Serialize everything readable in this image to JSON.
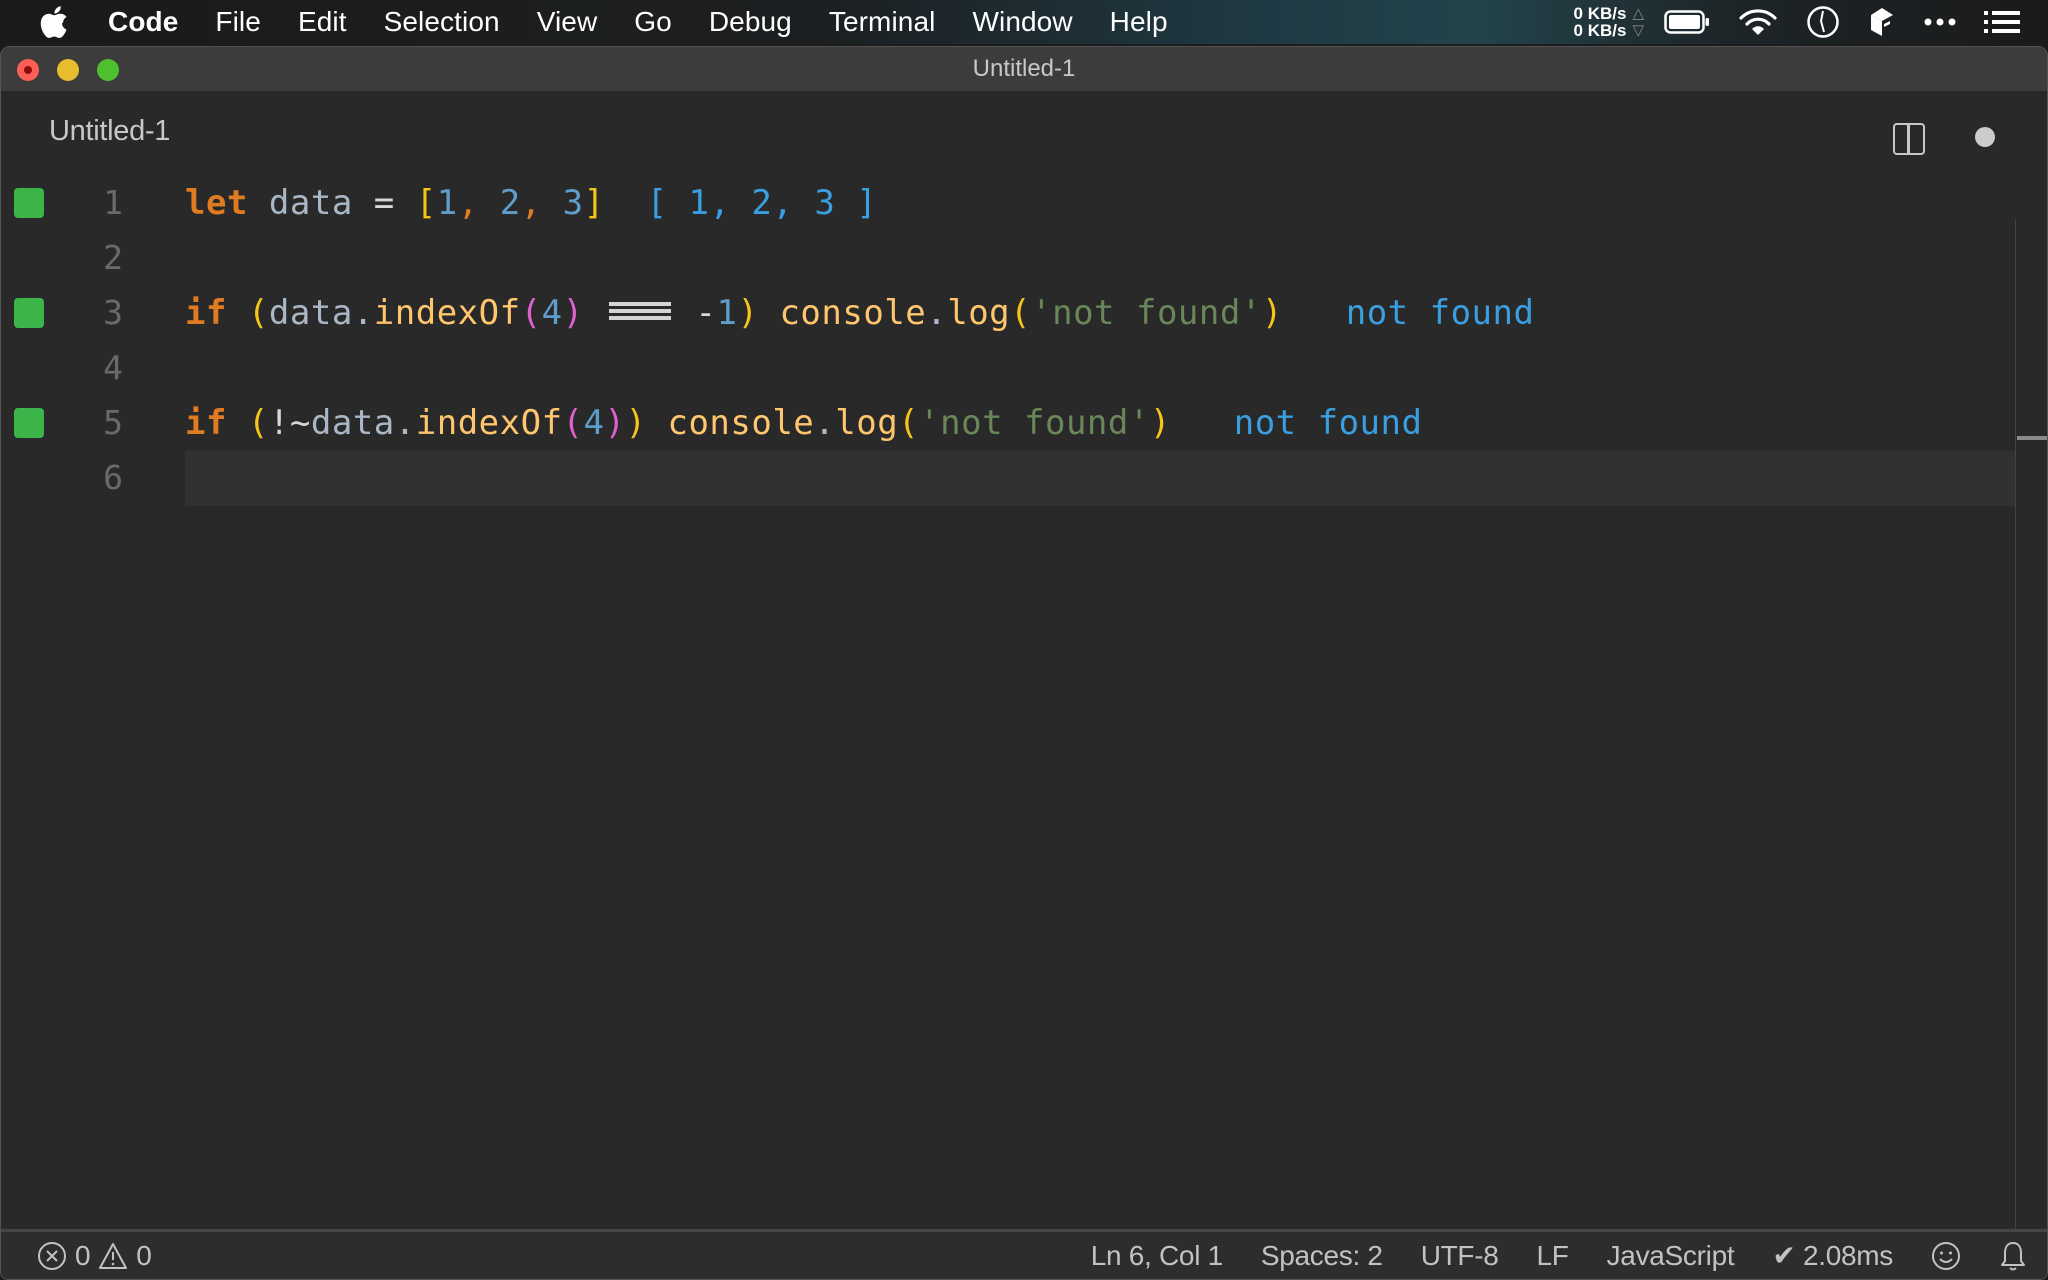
{
  "menubar": {
    "app_name": "Code",
    "items": [
      "File",
      "Edit",
      "Selection",
      "View",
      "Go",
      "Debug",
      "Terminal",
      "Window",
      "Help"
    ],
    "net_up": "0 KB/s",
    "net_down": "0 KB/s",
    "tray_icons": [
      "battery-icon",
      "wifi-icon",
      "clock-icon",
      "cube-icon",
      "more-icon",
      "list-icon"
    ]
  },
  "window": {
    "title": "Untitled-1"
  },
  "tab": {
    "title": "Untitled-1",
    "dirty": true
  },
  "editor": {
    "language": "JavaScript",
    "lines": [
      {
        "number": "1",
        "code": "let data = [1, 2, 3]",
        "result": "[ 1, 2, 3 ]",
        "marker": true
      },
      {
        "number": "2",
        "code": "",
        "result": "",
        "marker": false
      },
      {
        "number": "3",
        "code": "if (data.indexOf(4) === -1) console.log('not found')",
        "result": "not found",
        "marker": true
      },
      {
        "number": "4",
        "code": "",
        "result": "",
        "marker": false
      },
      {
        "number": "5",
        "code": "if (!~data.indexOf(4)) console.log('not found')",
        "result": "not found",
        "marker": true
      },
      {
        "number": "6",
        "code": "",
        "result": "",
        "marker": false
      }
    ],
    "tokens": {
      "let": "let",
      "data": "data",
      "eq": "=",
      "lbr": "[",
      "rbr": "]",
      "n1": "1",
      "n2": "2",
      "n3": "3",
      "n4": "4",
      "comma": ",",
      "if": "if",
      "lp": "(",
      "rp": ")",
      "dot": ".",
      "indexOf": "indexOf",
      "minus": "-",
      "console": "console",
      "log": "log",
      "str": "'not found'",
      "bang_tilde": "!~"
    },
    "results": {
      "line1": "[ 1, 2, 3 ]",
      "line3": "not found",
      "line5": "not found"
    }
  },
  "statusbar": {
    "errors": "0",
    "warnings": "0",
    "cursor": "Ln 6, Col 1",
    "indent": "Spaces: 2",
    "encoding": "UTF-8",
    "eol": "LF",
    "language": "JavaScript",
    "timing": "✔ 2.08ms"
  },
  "colors": {
    "keyword": "#e07b21",
    "identifier": "#a9b7c6",
    "number": "#5e9ecb",
    "string": "#6a8759",
    "function": "#ffc66d",
    "bracket_outer": "#f5c518",
    "bracket_inner": "#e060cf",
    "inline_result": "#3a9fe0",
    "gutter_marker": "#3bb54a"
  }
}
